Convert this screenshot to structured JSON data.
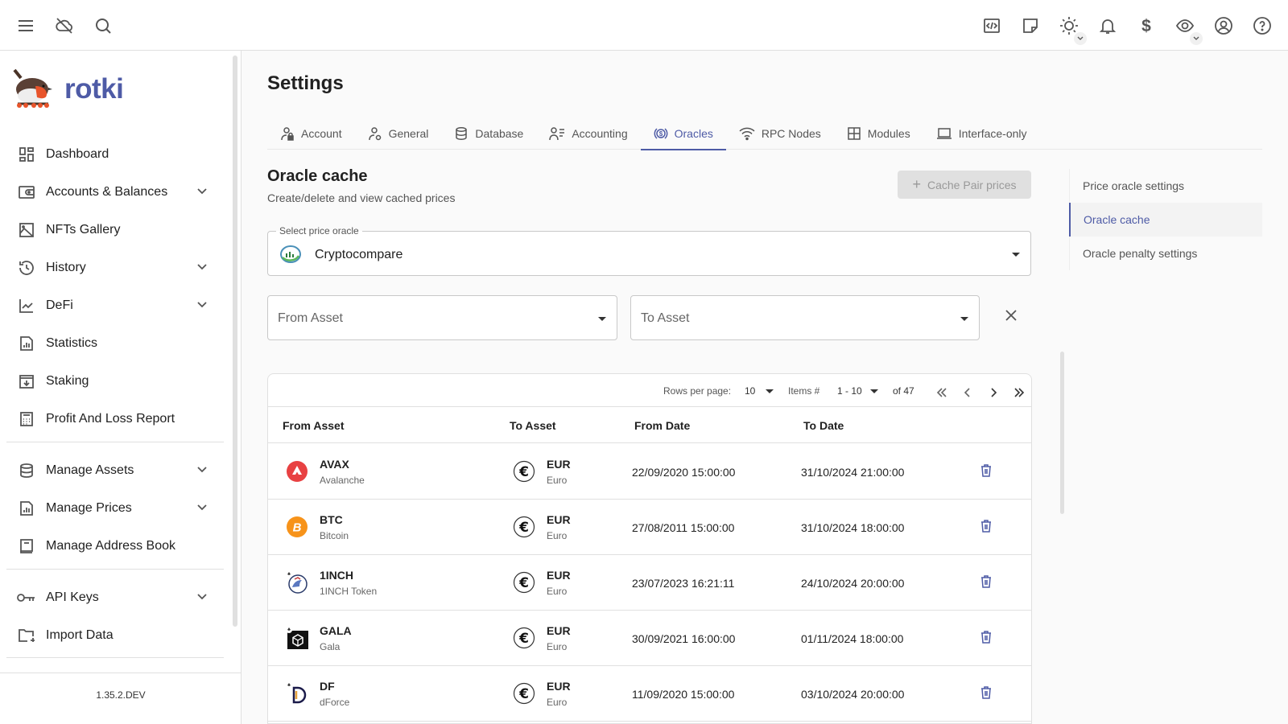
{
  "topbar": {
    "left_icons": [
      "menu-icon",
      "cloud-off-icon",
      "search-icon"
    ],
    "right_icons": [
      "code-icon",
      "sticky-note-icon",
      "theme-sun-icon",
      "bell-icon",
      "currency-dollar-icon",
      "eye-icon",
      "account-circle-icon",
      "help-icon"
    ]
  },
  "app": {
    "name": "rotki",
    "version": "1.35.2.DEV",
    "brand_color": "#4e5ba6"
  },
  "sidebar": {
    "items": [
      {
        "label": "Dashboard",
        "icon": "dashboard-icon",
        "expandable": false
      },
      {
        "label": "Accounts & Balances",
        "icon": "wallet-icon",
        "expandable": true
      },
      {
        "label": "NFTs Gallery",
        "icon": "image-icon",
        "expandable": false
      },
      {
        "label": "History",
        "icon": "history-icon",
        "expandable": true
      },
      {
        "label": "DeFi",
        "icon": "chart-line-icon",
        "expandable": true
      },
      {
        "label": "Statistics",
        "icon": "bar-chart-icon",
        "expandable": false
      },
      {
        "label": "Staking",
        "icon": "staking-icon",
        "expandable": false
      },
      {
        "label": "Profit And Loss Report",
        "icon": "calculator-icon",
        "expandable": false
      },
      {
        "label": "Manage Assets",
        "icon": "database-icon",
        "expandable": true
      },
      {
        "label": "Manage Prices",
        "icon": "bar-chart-icon",
        "expandable": true
      },
      {
        "label": "Manage Address Book",
        "icon": "book-icon",
        "expandable": false
      },
      {
        "label": "API Keys",
        "icon": "key-icon",
        "expandable": true
      },
      {
        "label": "Import Data",
        "icon": "folder-import-icon",
        "expandable": false
      }
    ]
  },
  "page": {
    "title": "Settings",
    "tabs": [
      {
        "label": "Account",
        "icon": "user-lock-icon",
        "active": false
      },
      {
        "label": "General",
        "icon": "user-settings-icon",
        "active": false
      },
      {
        "label": "Database",
        "icon": "database-icon",
        "active": false
      },
      {
        "label": "Accounting",
        "icon": "user-list-icon",
        "active": false
      },
      {
        "label": "Oracles",
        "icon": "coin-exchange-icon",
        "active": true
      },
      {
        "label": "RPC Nodes",
        "icon": "wifi-icon",
        "active": false
      },
      {
        "label": "Modules",
        "icon": "grid-icon",
        "active": false
      },
      {
        "label": "Interface-only",
        "icon": "laptop-icon",
        "active": false
      }
    ]
  },
  "oracle_cache": {
    "title": "Oracle cache",
    "subtitle": "Create/delete and view cached prices",
    "cache_button": "Cache Pair prices",
    "oracle_select": {
      "label": "Select price oracle",
      "value": "Cryptocompare"
    },
    "from_asset": {
      "placeholder": "From Asset"
    },
    "to_asset": {
      "placeholder": "To Asset"
    }
  },
  "pagination": {
    "rows_per_page_label": "Rows per page:",
    "rows_per_page": "10",
    "items_label": "Items #",
    "items_range": "1 - 10",
    "total": "of 47"
  },
  "table": {
    "columns": [
      "From Asset",
      "To Asset",
      "From Date",
      "To Date"
    ],
    "rows": [
      {
        "from_symbol": "AVAX",
        "from_name": "Avalanche",
        "to_symbol": "EUR",
        "to_name": "Euro",
        "from_date": "22/09/2020 15:00:00",
        "to_date": "31/10/2024 21:00:00"
      },
      {
        "from_symbol": "BTC",
        "from_name": "Bitcoin",
        "to_symbol": "EUR",
        "to_name": "Euro",
        "from_date": "27/08/2011 15:00:00",
        "to_date": "31/10/2024 18:00:00"
      },
      {
        "from_symbol": "1INCH",
        "from_name": "1INCH Token",
        "to_symbol": "EUR",
        "to_name": "Euro",
        "from_date": "23/07/2023 16:21:11",
        "to_date": "24/10/2024 20:00:00"
      },
      {
        "from_symbol": "GALA",
        "from_name": "Gala",
        "to_symbol": "EUR",
        "to_name": "Euro",
        "from_date": "30/09/2021 16:00:00",
        "to_date": "01/11/2024 18:00:00"
      },
      {
        "from_symbol": "DF",
        "from_name": "dForce",
        "to_symbol": "EUR",
        "to_name": "Euro",
        "from_date": "11/09/2020 15:00:00",
        "to_date": "03/10/2024 20:00:00"
      }
    ]
  },
  "right_nav": {
    "items": [
      {
        "label": "Price oracle settings",
        "active": false
      },
      {
        "label": "Oracle cache",
        "active": true
      },
      {
        "label": "Oracle penalty settings",
        "active": false
      }
    ]
  }
}
